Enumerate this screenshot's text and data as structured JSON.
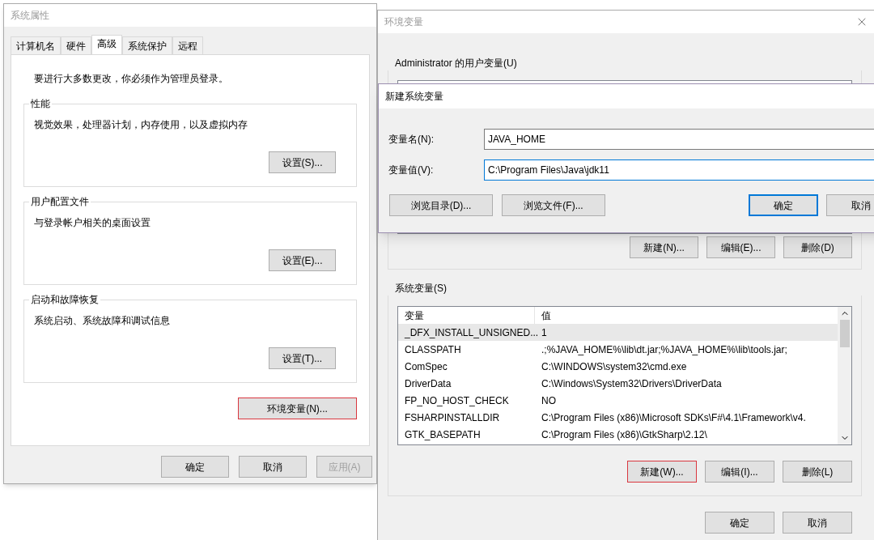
{
  "system_properties": {
    "title": "系统属性",
    "tabs": [
      {
        "label": "计算机名",
        "selected": false
      },
      {
        "label": "硬件",
        "selected": false
      },
      {
        "label": "高级",
        "selected": true
      },
      {
        "label": "系统保护",
        "selected": false
      },
      {
        "label": "远程",
        "selected": false
      }
    ],
    "notice": "要进行大多数更改，你必须作为管理员登录。",
    "groups": [
      {
        "title": "性能",
        "description": "视觉效果，处理器计划，内存使用，以及虚拟内存",
        "button": "设置(S)..."
      },
      {
        "title": "用户配置文件",
        "description": "与登录帐户相关的桌面设置",
        "button": "设置(E)..."
      },
      {
        "title": "启动和故障恢复",
        "description": "系统启动、系统故障和调试信息",
        "button": "设置(T)..."
      }
    ],
    "env_button": {
      "label": "环境变量(N)...",
      "highlighted": true
    },
    "buttons": [
      {
        "label": "确定",
        "disabled": false
      },
      {
        "label": "取消",
        "disabled": false
      },
      {
        "label": "应用(A)",
        "disabled": true
      }
    ]
  },
  "environment_variables": {
    "title": "环境变量",
    "user_section": {
      "title": "Administrator 的用户变量(U)",
      "buttons": [
        {
          "label": "新建(N)...",
          "highlighted": false
        },
        {
          "label": "编辑(E)...",
          "highlighted": false
        },
        {
          "label": "删除(D)",
          "highlighted": false
        }
      ]
    },
    "system_section": {
      "title": "系统变量(S)",
      "columns": [
        "变量",
        "值"
      ],
      "rows": [
        {
          "name": "_DFX_INSTALL_UNSIGNED...",
          "value": "1",
          "selected": true
        },
        {
          "name": "CLASSPATH",
          "value": ".;%JAVA_HOME%\\lib\\dt.jar;%JAVA_HOME%\\lib\\tools.jar;",
          "selected": false
        },
        {
          "name": "ComSpec",
          "value": "C:\\WINDOWS\\system32\\cmd.exe",
          "selected": false
        },
        {
          "name": "DriverData",
          "value": "C:\\Windows\\System32\\Drivers\\DriverData",
          "selected": false
        },
        {
          "name": "FP_NO_HOST_CHECK",
          "value": "NO",
          "selected": false
        },
        {
          "name": "FSHARPINSTALLDIR",
          "value": "C:\\Program Files (x86)\\Microsoft SDKs\\F#\\4.1\\Framework\\v4.",
          "selected": false
        },
        {
          "name": "GTK_BASEPATH",
          "value": "C:\\Program Files (x86)\\GtkSharp\\2.12\\",
          "selected": false
        }
      ],
      "buttons": [
        {
          "label": "新建(W)...",
          "highlighted": true
        },
        {
          "label": "编辑(I)...",
          "highlighted": false
        },
        {
          "label": "删除(L)",
          "highlighted": false
        }
      ]
    },
    "buttons": [
      "确定",
      "取消"
    ]
  },
  "new_variable_dialog": {
    "title": "新建系统变量",
    "fields": [
      {
        "label": "变量名(N):",
        "value": "JAVA_HOME",
        "focused": false
      },
      {
        "label": "变量值(V):",
        "value": "C:\\Program Files\\Java\\jdk11",
        "focused": true
      }
    ],
    "buttons": [
      {
        "label": "浏览目录(D)...",
        "default": false
      },
      {
        "label": "浏览文件(F)...",
        "default": false
      },
      {
        "label": "确定",
        "default": true
      },
      {
        "label": "取消",
        "default": false
      }
    ]
  }
}
